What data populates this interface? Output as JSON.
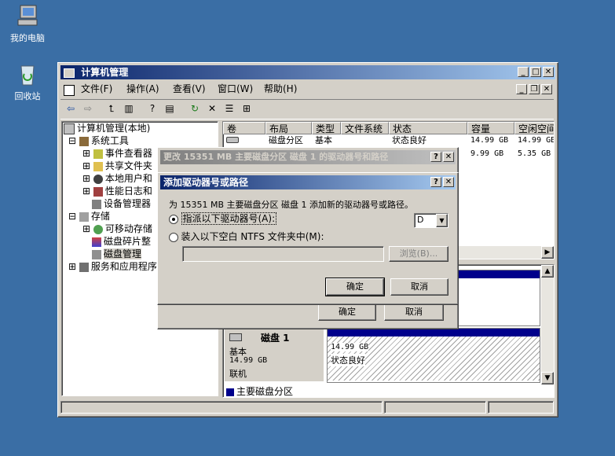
{
  "desktop": {
    "icons": [
      {
        "label": "我的电脑",
        "icon": "my-computer-icon"
      },
      {
        "label": "回收站",
        "icon": "recycle-bin-icon"
      }
    ]
  },
  "main_window": {
    "title": "计算机管理",
    "menu": [
      "文件(F)",
      "操作(A)",
      "查看(V)",
      "窗口(W)",
      "帮助(H)"
    ],
    "tree": [
      {
        "label": "计算机管理(本地)"
      },
      {
        "label": "系统工具"
      },
      {
        "label": "事件查看器"
      },
      {
        "label": "共享文件夹"
      },
      {
        "label": "本地用户和"
      },
      {
        "label": "性能日志和"
      },
      {
        "label": "设备管理器"
      },
      {
        "label": "存储"
      },
      {
        "label": "可移动存储"
      },
      {
        "label": "磁盘碎片整"
      },
      {
        "label": "磁盘管理"
      },
      {
        "label": "服务和应用程序"
      }
    ],
    "columns": [
      "卷",
      "布局",
      "类型",
      "文件系统",
      "状态",
      "容量",
      "空闲空间"
    ],
    "rows": [
      [
        "",
        "磁盘分区",
        "基本",
        "",
        "状态良好",
        "14.99 GB",
        "14.99 GB"
      ],
      [
        "",
        "",
        "",
        "",
        "",
        "9.99 GB",
        "5.35 GB"
      ]
    ],
    "disk": {
      "name": "磁盘 1",
      "type": "基本",
      "size": "14.99 GB",
      "status": "联机",
      "partition_size": "14.99 GB",
      "partition_status": "状态良好"
    },
    "legend": "主要磁盘分区"
  },
  "change_dialog": {
    "title": "更改 15351 MB  主要磁盘分区  磁盘 1 的驱动器号和路径",
    "ok": "确定",
    "cancel": "取消"
  },
  "add_dialog": {
    "title": "添加驱动器号或路径",
    "description": "为 15351 MB  主要磁盘分区 磁盘 1 添加新的驱动器号或路径。",
    "option_letter": "指派以下驱动器号(A):",
    "drive_letter": "D",
    "option_folder": "装入以下空白 NTFS 文件夹中(M):",
    "folder_path": "",
    "browse": "浏览(B)...",
    "ok": "确定",
    "cancel": "取消"
  },
  "colors": {
    "desktop": "#3a6ea5",
    "title_active": "#0a246a",
    "primary_partition": "#00008b"
  }
}
